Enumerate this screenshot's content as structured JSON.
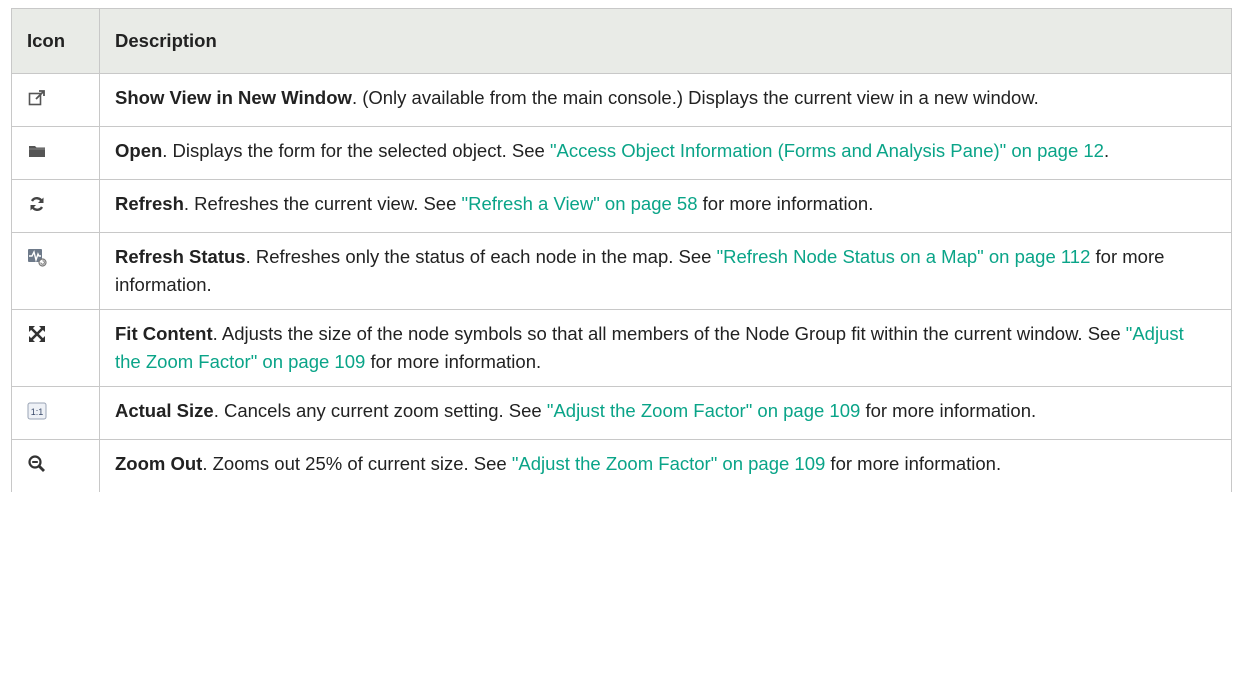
{
  "table": {
    "headers": {
      "icon": "Icon",
      "description": "Description"
    },
    "rows": [
      {
        "icon": "show-in-new-window-icon",
        "name": "Show View in New Window",
        "text": ". (Only available from the main console.) Displays the current view in a new window.",
        "link": "",
        "after": ""
      },
      {
        "icon": "open-folder-icon",
        "name": "Open",
        "text": ". Displays the form for the selected object. See ",
        "link": "\"Access Object Information (Forms and Analysis Pane)\" on page 12",
        "after": "."
      },
      {
        "icon": "refresh-icon",
        "name": "Refresh",
        "text": ". Refreshes the current view. See ",
        "link": "\"Refresh a View\" on page 58",
        "after": " for more information."
      },
      {
        "icon": "refresh-status-icon",
        "name": "Refresh Status",
        "text": ". Refreshes only the status of each node in the map. See ",
        "link": "\"Refresh Node Status on a Map\" on page 112",
        "after": " for more information."
      },
      {
        "icon": "fit-content-icon",
        "name": "Fit Content",
        "text": ". Adjusts the size of the node symbols so that all members of the Node Group fit within the current window. See ",
        "link": "\"Adjust the Zoom Factor\" on page 109",
        "after": " for more information."
      },
      {
        "icon": "actual-size-icon",
        "icon_label": "1:1",
        "name": "Actual Size",
        "text": ". Cancels any current zoom setting. See ",
        "link": "\"Adjust the Zoom Factor\" on page 109",
        "after": " for more information."
      },
      {
        "icon": "zoom-out-icon",
        "name": "Zoom Out",
        "text": ". Zooms out 25% of current size. See ",
        "link": "\"Adjust the Zoom Factor\" on page 109",
        "after": " for more information."
      }
    ]
  }
}
